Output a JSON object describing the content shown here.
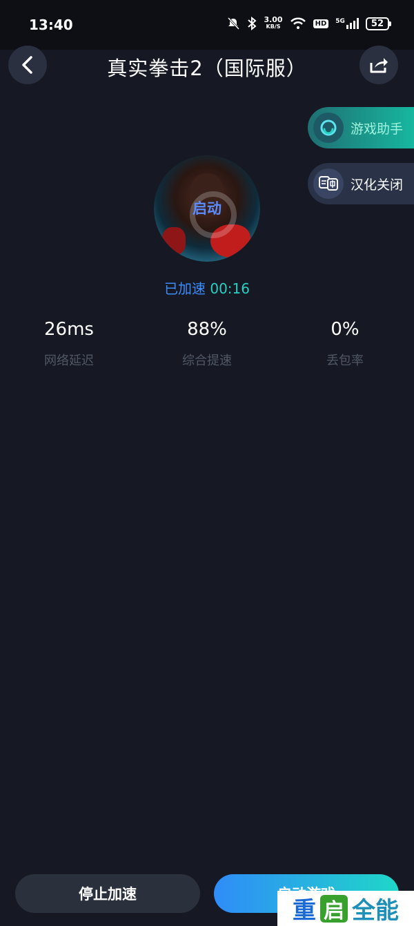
{
  "status_bar": {
    "time": "13:40",
    "net_speed_value": "3.00",
    "net_speed_unit": "KB/S",
    "hd": "HD",
    "network": "5G",
    "battery": "52",
    "icons": [
      "mute-bell-icon",
      "bluetooth-icon",
      "wifi-icon",
      "signal-icon",
      "battery-icon"
    ]
  },
  "header": {
    "title": "真实拳击2（国际服）",
    "back_icon": "back-chevron-icon",
    "share_icon": "share-icon"
  },
  "side_actions": {
    "assistant_label": "游戏助手",
    "translate_label": "汉化关闭"
  },
  "game": {
    "start_label": "启动",
    "accel_label": "已加速",
    "accel_time": "00:16"
  },
  "stats": [
    {
      "value": "26ms",
      "label": "网络延迟"
    },
    {
      "value": "88%",
      "label": "综合提速"
    },
    {
      "value": "0%",
      "label": "丢包率"
    }
  ],
  "buttons": {
    "stop_label": "停止加速",
    "launch_label": "启动游戏"
  },
  "watermark": {
    "char1": "重",
    "char2": "启",
    "char3": "全能"
  },
  "colors": {
    "background": "#161923",
    "accent_blue": "#3a8cff",
    "accent_teal": "#27d2c3"
  }
}
